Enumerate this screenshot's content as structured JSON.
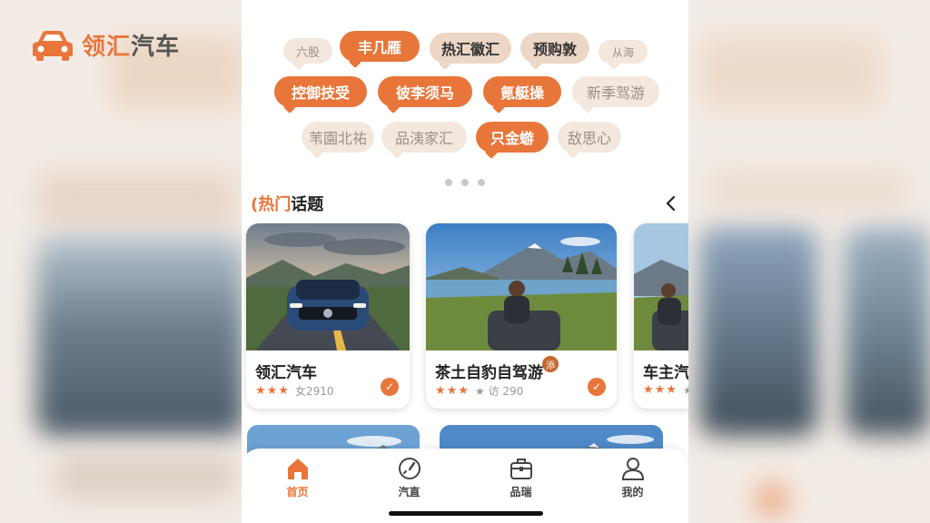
{
  "brand": {
    "name_part1": "领汇",
    "name_part2": "汽车",
    "accent": "#e8763a"
  },
  "tags": [
    {
      "label": "六股",
      "style": "soft"
    },
    {
      "label": "丰几雁",
      "style": "hot"
    },
    {
      "label": "热汇徽汇",
      "style": "mid"
    },
    {
      "label": "预购敦",
      "style": "mid"
    },
    {
      "label": "从海",
      "style": "soft"
    },
    {
      "label": "控御技受",
      "style": "hot"
    },
    {
      "label": "彼李须马",
      "style": "hot"
    },
    {
      "label": "氪艇操",
      "style": "hot"
    },
    {
      "label": "新季驾游",
      "style": "soft"
    },
    {
      "label": "苇園北祐",
      "style": "soft"
    },
    {
      "label": "品洟家汇",
      "style": "soft"
    },
    {
      "label": "只金蝣",
      "style": "hot"
    },
    {
      "label": "敌思心",
      "style": "soft"
    }
  ],
  "section": {
    "accent_char": "(热门",
    "rest": "话题"
  },
  "cards": [
    {
      "title": "领汇汽车",
      "stars": "★★★",
      "meta": "女2910"
    },
    {
      "title": "茶土自豹自驾游",
      "stars": "★★★",
      "meta": "★ 访 290"
    },
    {
      "title": "车主汽",
      "stars": "★★★",
      "meta": "★"
    }
  ],
  "badge": "添",
  "tabbar": {
    "items": [
      {
        "label": "首页",
        "icon": "home-icon",
        "active": true
      },
      {
        "label": "汽直",
        "icon": "speedometer-icon",
        "active": false
      },
      {
        "label": "品瑞",
        "icon": "briefcase-icon",
        "active": false
      },
      {
        "label": "我的",
        "icon": "user-icon",
        "active": false
      }
    ]
  }
}
